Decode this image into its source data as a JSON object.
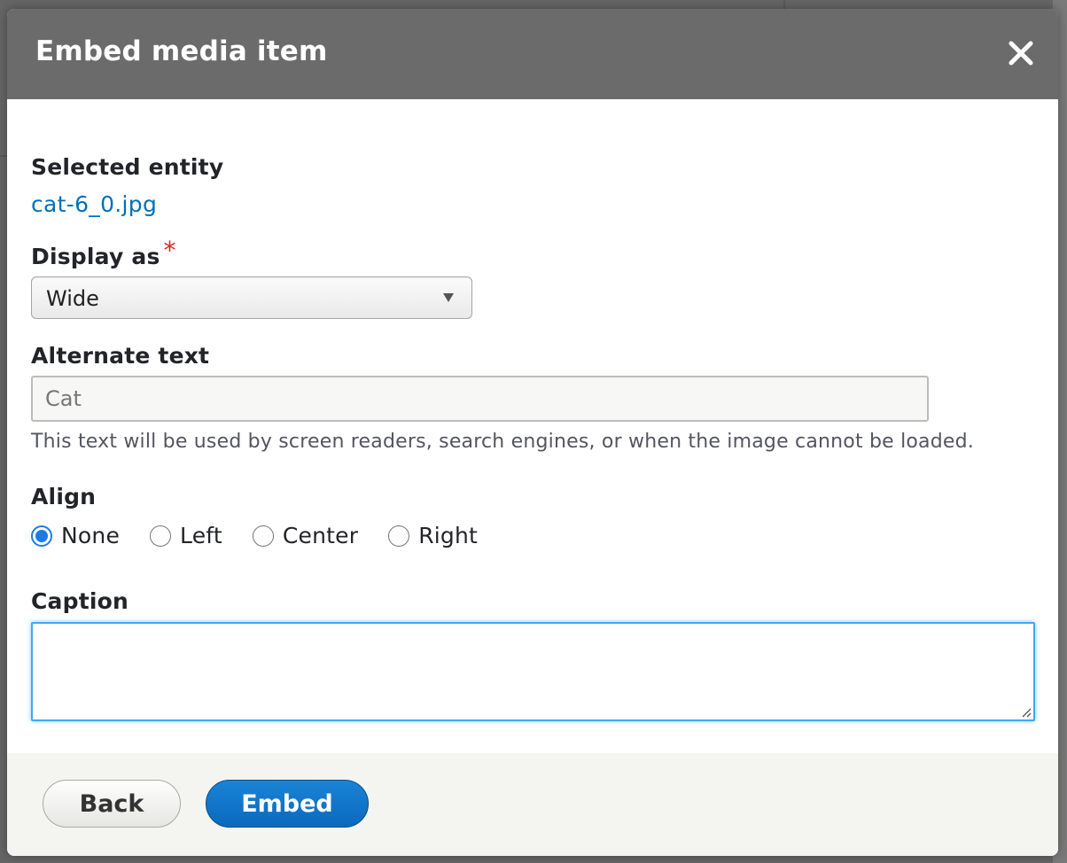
{
  "dialog": {
    "title": "Embed media item",
    "close_label": "×"
  },
  "selected_entity": {
    "label": "Selected entity",
    "link_text": "cat-6_0.jpg"
  },
  "display_as": {
    "label": "Display as",
    "required_marker": "*",
    "selected_value": "Wide"
  },
  "alternate_text": {
    "label": "Alternate text",
    "value": "Cat",
    "description": "This text will be used by screen readers, search engines, or when the image cannot be loaded."
  },
  "align": {
    "label": "Align",
    "options": [
      {
        "label": "None",
        "checked": true
      },
      {
        "label": "Left",
        "checked": false
      },
      {
        "label": "Center",
        "checked": false
      },
      {
        "label": "Right",
        "checked": false
      }
    ]
  },
  "caption": {
    "label": "Caption",
    "value": ""
  },
  "footer": {
    "back_label": "Back",
    "embed_label": "Embed"
  },
  "colors": {
    "titlebar": "#6b6b6b",
    "link": "#0071b8",
    "required": "#dc2323",
    "primary_button": "#0a69bd",
    "focus": "#40a8f2"
  }
}
